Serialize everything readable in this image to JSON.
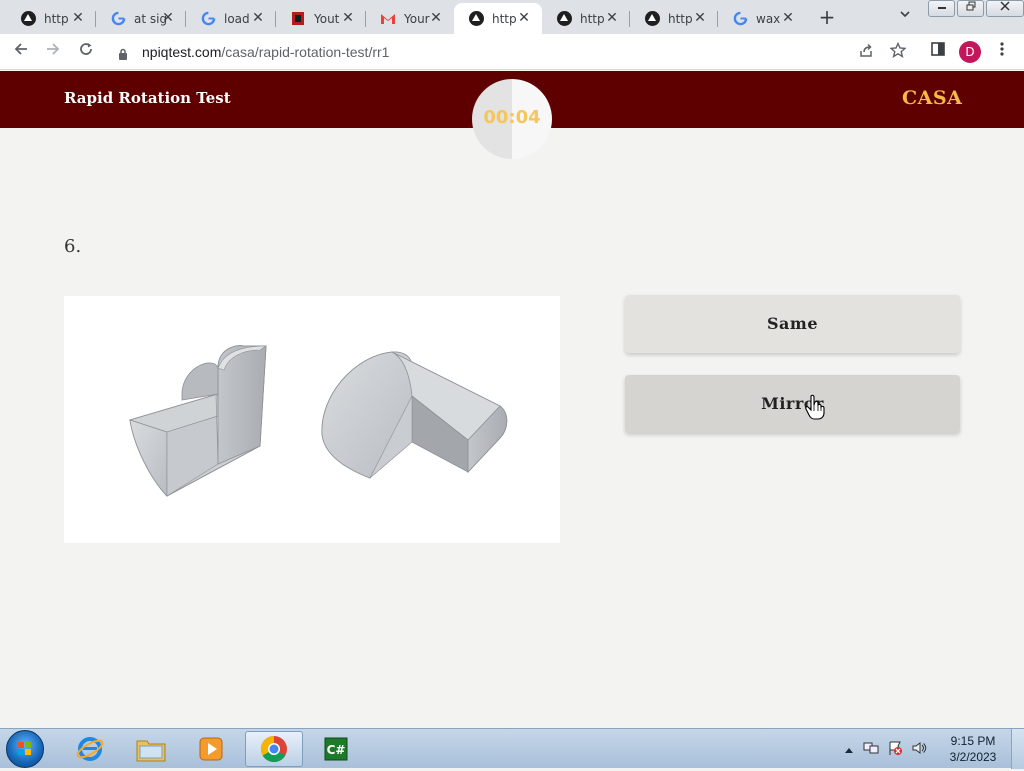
{
  "browser": {
    "tabs": [
      {
        "title": "http",
        "icon": "triangle-logo-icon"
      },
      {
        "title": "at sig",
        "icon": "google-icon"
      },
      {
        "title": "load",
        "icon": "google-icon"
      },
      {
        "title": "Yout",
        "icon": "youtube-icon"
      },
      {
        "title": "Your",
        "icon": "gmail-icon"
      },
      {
        "title": "http",
        "icon": "triangle-logo-icon",
        "active": true
      },
      {
        "title": "http",
        "icon": "triangle-logo-icon"
      },
      {
        "title": "http",
        "icon": "triangle-logo-icon"
      },
      {
        "title": "wax",
        "icon": "google-icon"
      }
    ],
    "new_tab": "+",
    "close_glyph": "✕",
    "url_host": "npiqtest.com",
    "url_path": "/casa/rapid-rotation-test/rr1",
    "profile_initial": "D"
  },
  "page": {
    "site_title": "Rapid Rotation Test",
    "brand": "CASA",
    "timer": "00:04",
    "timer_fraction_elapsed": 0.5,
    "question_number": "6.",
    "answers": {
      "same": "Same",
      "mirror": "Mirror"
    }
  },
  "taskbar": {
    "time": "9:15 PM",
    "date": "3/2/2023"
  },
  "colors": {
    "header_bg": "#5e0000",
    "brand_gold": "#f5b946",
    "timer_text": "#f5c65a",
    "button_bg": "#e3e2df"
  }
}
